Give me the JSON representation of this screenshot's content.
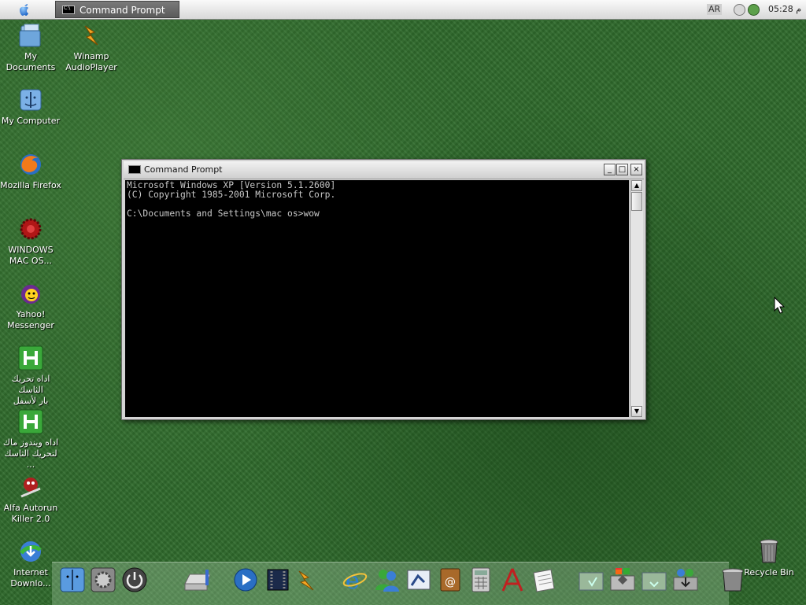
{
  "menubar": {
    "active_task": "Command Prompt",
    "language": "AR",
    "clock": "05:28 م"
  },
  "desktop_icons": [
    {
      "label": "My Documents",
      "icon": "folder-icon"
    },
    {
      "label": "Winamp\nAudioPlayer",
      "icon": "winamp-icon"
    },
    {
      "label": "My Computer",
      "icon": "computer-icon"
    },
    {
      "label": "Mozilla Firefox",
      "icon": "firefox-icon"
    },
    {
      "label": "WINDOWS\nMAC OS...",
      "icon": "red-gear-icon"
    },
    {
      "label": "Yahoo!\nMessenger",
      "icon": "yahoo-icon"
    },
    {
      "label": "اداه تحريك الثاسك\nبار لأسفل",
      "icon": "h-app-icon"
    },
    {
      "label": "اداه ويندوز ماك\nلتحريك الثاسك\n...",
      "icon": "h-app-icon"
    },
    {
      "label": "Alfa Autorun\nKiller 2.0",
      "icon": "autorun-killer-icon"
    },
    {
      "label": "Internet\nDownlo...",
      "icon": "download-manager-icon"
    }
  ],
  "cmd_window": {
    "title": "Command Prompt",
    "minimize": "_",
    "maximize": "□",
    "close": "×",
    "output": "Microsoft Windows XP [Version 5.1.2600]\n(C) Copyright 1985-2001 Microsoft Corp.\n\nC:\\Documents and Settings\\mac os>wow",
    "scroll_up": "▲",
    "scroll_down": "▼"
  },
  "recycle_bin": {
    "label": "Recycle Bin"
  },
  "dock_items": [
    "finder-icon",
    "system-preferences-icon",
    "shutdown-icon",
    "drive-icon",
    "media-player-icon",
    "movie-icon",
    "winamp-icon",
    "internet-explorer-icon",
    "msn-messenger-icon",
    "mail-icon",
    "address-book-icon",
    "calculator-icon",
    "text-editor-icon",
    "notepad-icon",
    "windows-folder-icon",
    "control-panel-icon",
    "folder-icon",
    "downloads-icon",
    "trash-icon"
  ]
}
